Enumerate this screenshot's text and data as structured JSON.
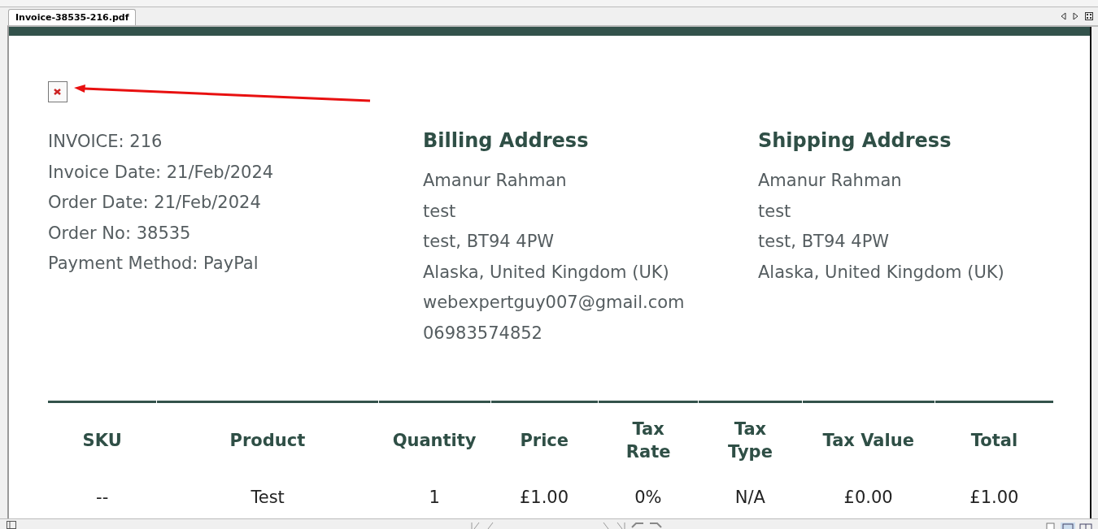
{
  "tab": {
    "label": "Invoice-38535-216.pdf",
    "selected": true
  },
  "invoice": {
    "details": [
      "INVOICE: 216",
      "Invoice Date: 21/Feb/2024",
      "Order Date: 21/Feb/2024",
      "Order No: 38535",
      "Payment Method: PayPal"
    ]
  },
  "billing": {
    "title": "Billing Address",
    "lines": [
      "Amanur Rahman",
      "test",
      "test, BT94 4PW",
      "Alaska, United Kingdom (UK)",
      "webexpertguy007@gmail.com",
      "06983574852"
    ]
  },
  "shipping": {
    "title": "Shipping Address",
    "lines": [
      "Amanur Rahman",
      "test",
      "test, BT94 4PW",
      "Alaska, United Kingdom (UK)"
    ]
  },
  "table": {
    "columns": [
      "SKU",
      "Product",
      "Quantity",
      "Price",
      "Tax Rate",
      "Tax Type",
      "Tax Value",
      "Total"
    ],
    "rows": [
      [
        "--",
        "Test",
        "1",
        "£1.00",
        "0%",
        "N/A",
        "£0.00",
        "£1.00"
      ]
    ]
  }
}
